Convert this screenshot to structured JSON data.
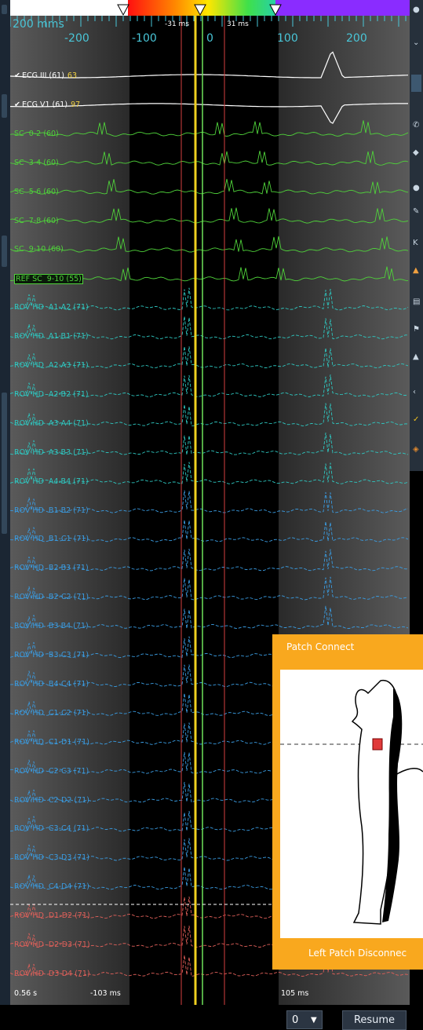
{
  "header": {
    "sweep_speed": "200 mms",
    "ticks": [
      "-200",
      "-100",
      "0",
      "100",
      "200"
    ],
    "caliper_left": "-31 ms",
    "caliper_right": "31 ms"
  },
  "colors": {
    "ecg": "#ffffff",
    "cs": "#4fd23a",
    "hd_a": "#2ec7c0",
    "hd_b": "#3a9be0",
    "hd_d": "#e0605a",
    "accent_orange": "#f9a81e",
    "scale": "#49c6d8",
    "marker_red": "#d64040",
    "marker_green": "#6fe35a"
  },
  "channels": [
    {
      "label": "ECG III (61)",
      "value": "63",
      "checked": true,
      "group": "ecg"
    },
    {
      "label": "ECG V1 (61)",
      "value": "97",
      "checked": true,
      "group": "ecg"
    },
    {
      "label": "SC  0-2 (60)",
      "group": "cs"
    },
    {
      "label": "SC  3-4 (60)",
      "group": "cs"
    },
    {
      "label": "SC  5-6 (60)",
      "group": "cs"
    },
    {
      "label": "SC  7-8 (60)",
      "group": "cs"
    },
    {
      "label": "SC  9-10 (60)",
      "group": "cs"
    },
    {
      "label": "REF SC  9-10 (55)",
      "group": "ref"
    },
    {
      "label": "ROV HD  A1-A2 (71)",
      "group": "hd_a"
    },
    {
      "label": "ROV HD  A1-B1 (71)",
      "group": "hd_a"
    },
    {
      "label": "ROV HD  A2-A3 (71)",
      "group": "hd_a"
    },
    {
      "label": "ROV HD  A2-B2 (71)",
      "group": "hd_a"
    },
    {
      "label": "ROV HD  A3-A4 (71)",
      "group": "hd_a"
    },
    {
      "label": "ROV HD  A3-B3 (71)",
      "group": "hd_a"
    },
    {
      "label": "ROV HD  A4-B4 (71)",
      "group": "hd_a"
    },
    {
      "label": "ROV HD  B1-B2 (71)",
      "group": "hd_b"
    },
    {
      "label": "ROV HD  B1-C1 (71)",
      "group": "hd_b"
    },
    {
      "label": "ROV HD  B2-B3 (71)",
      "group": "hd_b"
    },
    {
      "label": "ROV HD  B2-C2 (71)",
      "group": "hd_b"
    },
    {
      "label": "ROV HD  B3-B4 (71)",
      "group": "hd_b"
    },
    {
      "label": "ROV HD  B3-C3 (71)",
      "group": "hd_b"
    },
    {
      "label": "ROV HD  B4-C4 (71)",
      "group": "hd_b"
    },
    {
      "label": "ROV HD  C1-C2 (71)",
      "group": "hd_b"
    },
    {
      "label": "ROV HD  C1-D1 (71)",
      "group": "hd_b"
    },
    {
      "label": "ROV HD  C2-C3 (71)",
      "group": "hd_b"
    },
    {
      "label": "ROV HD  C2-D2 (71)",
      "group": "hd_b"
    },
    {
      "label": "ROV HD  C3-C4 (71)",
      "group": "hd_b"
    },
    {
      "label": "ROV HD  C3-D3 (71)",
      "group": "hd_b"
    },
    {
      "label": "ROV HD  C4-D4 (71)",
      "group": "hd_b"
    },
    {
      "label": "ROV HD  D1-D2 (71)",
      "group": "hd_d"
    },
    {
      "label": "ROV HD  D2-D3 (71)",
      "group": "hd_d"
    },
    {
      "label": "ROV HD  D3-D4 (71)",
      "group": "hd_d"
    }
  ],
  "footer": {
    "time_left": "0.56 s",
    "marker_left": "-103 ms",
    "marker_right": "105 ms"
  },
  "controls": {
    "zoom_value": "0",
    "resume_label": "Resume"
  },
  "patch_popup": {
    "title": "Patch Connect",
    "status": "Left Patch Disconnec"
  }
}
